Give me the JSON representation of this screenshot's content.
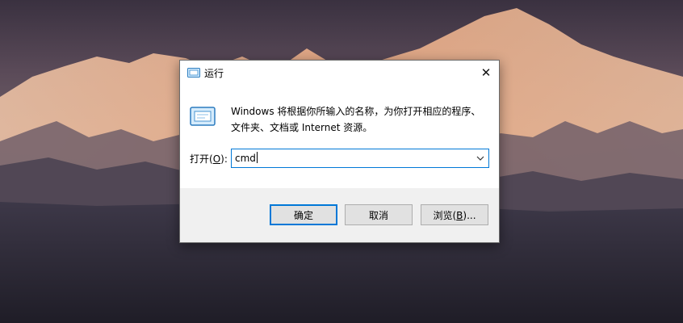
{
  "dialog": {
    "title": "运行",
    "close_glyph": "✕",
    "icon": "run-program-icon",
    "description_line1": "Windows 将根据你所输入的名称，为你打开相应的程序、",
    "description_line2": "文件夹、文档或 Internet 资源。",
    "open_label_prefix": "打开(",
    "open_label_key": "O",
    "open_label_suffix": "):",
    "input_value": "cmd",
    "buttons": {
      "ok": "确定",
      "cancel": "取消",
      "browse_prefix": "浏览(",
      "browse_key": "B",
      "browse_suffix": ")..."
    }
  },
  "colors": {
    "accent": "#0078d7",
    "button_face": "#e1e1e1",
    "footer": "#f0f0f0"
  }
}
